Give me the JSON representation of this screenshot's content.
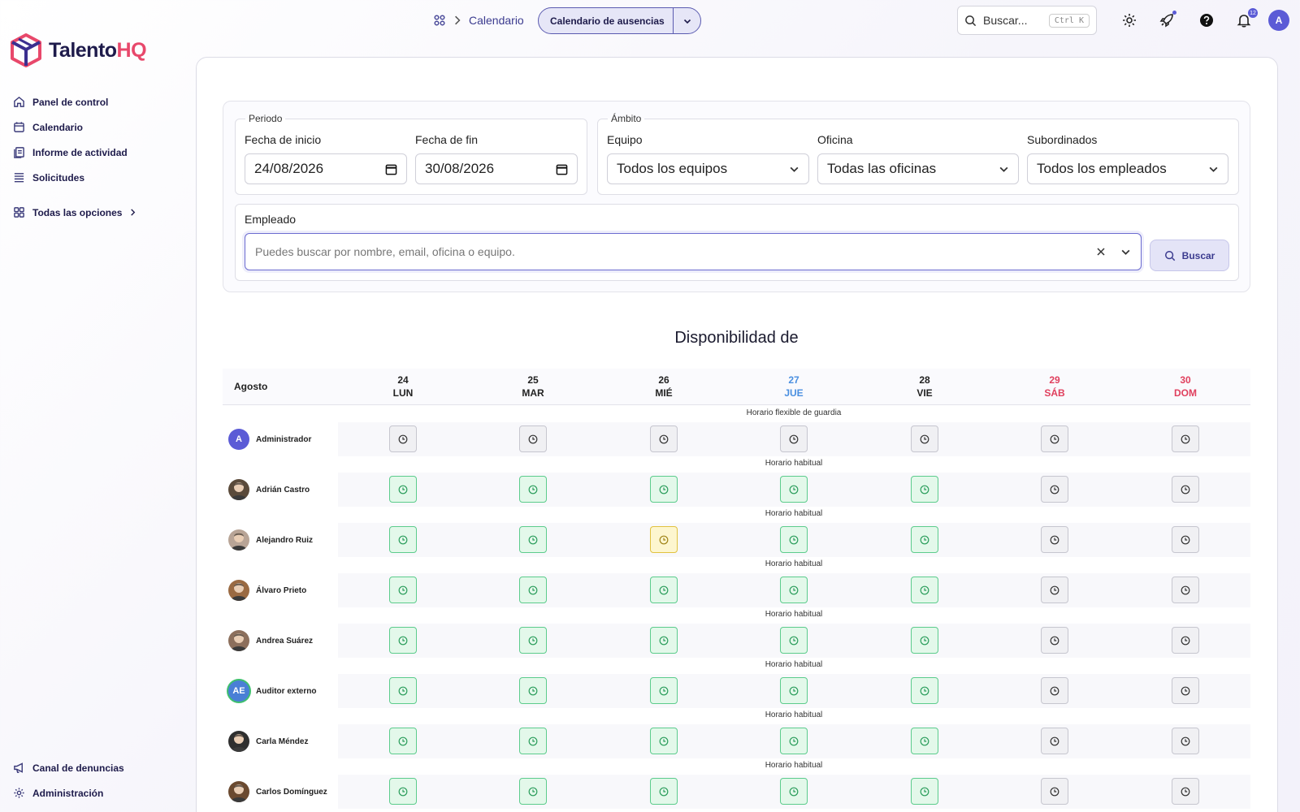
{
  "app": {
    "brand_main": "Talento",
    "brand_accent": "HQ"
  },
  "sidebar": {
    "items": [
      {
        "label": "Panel de control",
        "icon": "home-icon"
      },
      {
        "label": "Calendario",
        "icon": "calendar-icon"
      },
      {
        "label": "Informe de actividad",
        "icon": "report-icon"
      },
      {
        "label": "Solicitudes",
        "icon": "list-icon"
      }
    ],
    "all_options": "Todas las opciones",
    "bottom": [
      {
        "label": "Canal de denuncias",
        "icon": "megaphone-icon"
      },
      {
        "label": "Administración",
        "icon": "gear-icon"
      }
    ]
  },
  "header": {
    "breadcrumb": "Calendario",
    "view_selector": "Calendario de ausencias",
    "search_placeholder": "Buscar...",
    "search_shortcut": "Ctrl K",
    "notifications_count": "12",
    "user_initial": "A"
  },
  "filters": {
    "period_legend": "Periodo",
    "start_label": "Fecha de inicio",
    "start_value": "24/08/2026",
    "end_label": "Fecha de fin",
    "end_value": "30/08/2026",
    "scope_legend": "Ámbito",
    "team_label": "Equipo",
    "team_value": "Todos los equipos",
    "office_label": "Oficina",
    "office_value": "Todas las oficinas",
    "subordinates_label": "Subordinados",
    "subordinates_value": "Todos los empleados",
    "employee_label": "Empleado",
    "employee_placeholder": "Puedes buscar por nombre, email, oficina o equipo.",
    "search_button": "Buscar"
  },
  "availability": {
    "title": "Disponibilidad de",
    "month": "Agosto",
    "days": [
      {
        "num": "24",
        "name": "LUN",
        "type": "normal"
      },
      {
        "num": "25",
        "name": "MAR",
        "type": "normal"
      },
      {
        "num": "26",
        "name": "MIÉ",
        "type": "normal"
      },
      {
        "num": "27",
        "name": "JUE",
        "type": "today"
      },
      {
        "num": "28",
        "name": "VIE",
        "type": "normal"
      },
      {
        "num": "29",
        "name": "SÁB",
        "type": "weekend"
      },
      {
        "num": "30",
        "name": "DOM",
        "type": "weekend"
      }
    ],
    "employees": [
      {
        "name": "Administrador",
        "schedule": "Horario flexible de guardia",
        "avatar_initials": "A",
        "avatar_color": "#5b5bd6",
        "status": [
          "gray",
          "gray",
          "gray",
          "gray",
          "gray",
          "gray",
          "gray"
        ]
      },
      {
        "name": "Adrián Castro",
        "schedule": "Horario habitual",
        "avatar_initials": "",
        "avatar_color": "#5a4a3a",
        "status": [
          "green",
          "green",
          "green",
          "green",
          "green",
          "gray",
          "gray"
        ]
      },
      {
        "name": "Alejandro Ruiz",
        "schedule": "Horario habitual",
        "avatar_initials": "",
        "avatar_color": "#b8a496",
        "status": [
          "green",
          "green",
          "yellow",
          "green",
          "green",
          "gray",
          "gray"
        ]
      },
      {
        "name": "Álvaro Prieto",
        "schedule": "Horario habitual",
        "avatar_initials": "",
        "avatar_color": "#9a6a42",
        "status": [
          "green",
          "green",
          "green",
          "green",
          "green",
          "gray",
          "gray"
        ]
      },
      {
        "name": "Andrea Suárez",
        "schedule": "Horario habitual",
        "avatar_initials": "",
        "avatar_color": "#8c6f5c",
        "status": [
          "green",
          "green",
          "green",
          "green",
          "green",
          "gray",
          "gray"
        ]
      },
      {
        "name": "Auditor externo",
        "schedule": "Horario habitual",
        "avatar_initials": "AE",
        "avatar_color": "#4a7fd6",
        "status": [
          "green",
          "green",
          "green",
          "green",
          "green",
          "gray",
          "gray"
        ]
      },
      {
        "name": "Carla Méndez",
        "schedule": "Horario habitual",
        "avatar_initials": "",
        "avatar_color": "#2f2f2f",
        "status": [
          "green",
          "green",
          "green",
          "green",
          "green",
          "gray",
          "gray"
        ]
      },
      {
        "name": "Carlos Domínguez",
        "schedule": "Horario habitual",
        "avatar_initials": "",
        "avatar_color": "#6b4a30",
        "status": [
          "green",
          "green",
          "green",
          "green",
          "green",
          "gray",
          "gray"
        ]
      }
    ]
  },
  "colors": {
    "accent": "#5b5bd6",
    "brand_accent": "#e8486b",
    "today": "#4a8fe0",
    "weekend": "#e0405e",
    "available": "#5ccc8c",
    "pending": "#e1c23f"
  }
}
